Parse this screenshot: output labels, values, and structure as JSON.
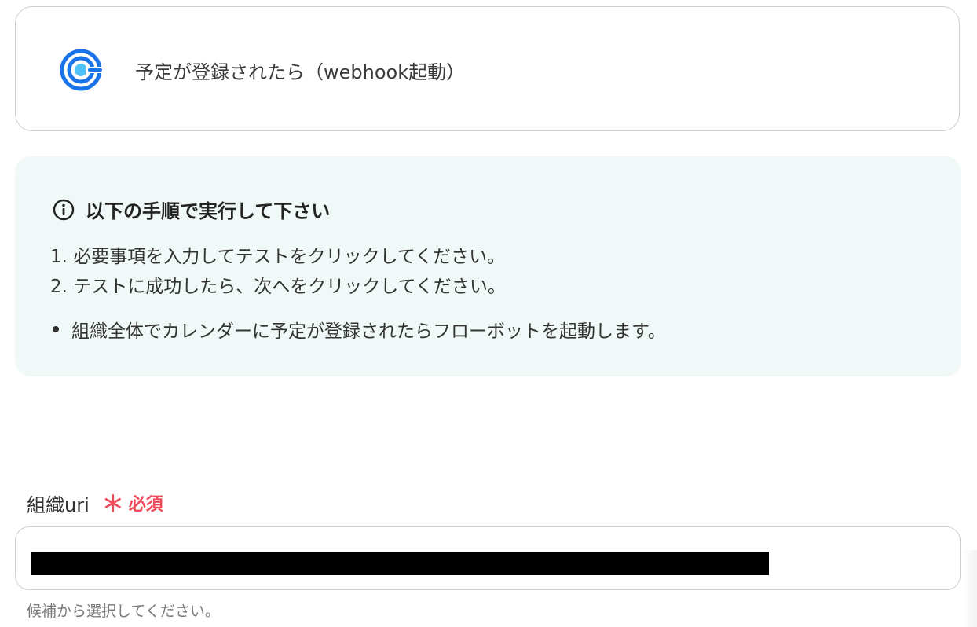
{
  "trigger": {
    "icon": "calendar-c-logo-icon",
    "title": "予定が登録されたら（webhook起動）",
    "brand_color": "#1a73e8"
  },
  "instructions": {
    "icon": "info-circle-icon",
    "heading": "以下の手順で実行して下さい",
    "steps": [
      "1. 必要事項を入力してテストをクリックしてください。",
      "2. テストに成功したら、次へをクリックしてください。"
    ],
    "note": "組織全体でカレンダーに予定が登録されたらフローボットを起動します。",
    "background_color": "#f1f9f8"
  },
  "field": {
    "label": "組織uri",
    "required_mark": "＊",
    "required_text": "必須",
    "required_color": "#ef4a5a",
    "value_redacted": true,
    "hint": "候補から選択してください。"
  }
}
